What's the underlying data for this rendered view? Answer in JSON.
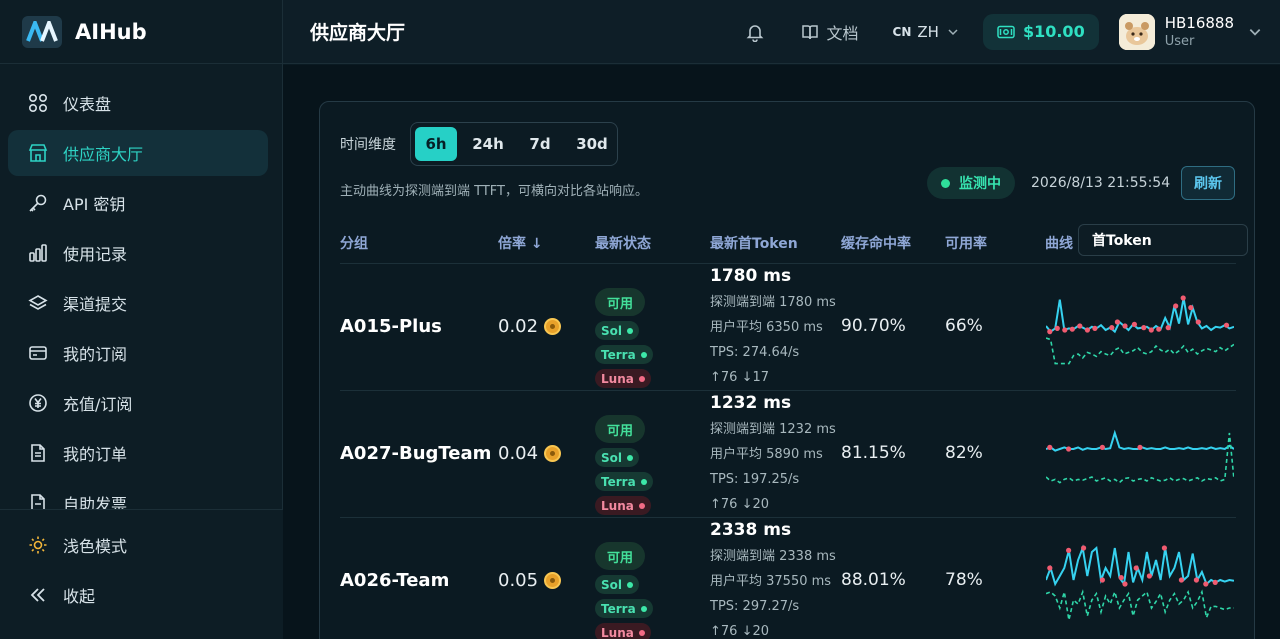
{
  "brand": {
    "name": "AIHub"
  },
  "sidebar": {
    "items": [
      {
        "label": "仪表盘",
        "icon": "dashboard-icon"
      },
      {
        "label": "供应商大厅",
        "icon": "store-icon",
        "active": true
      },
      {
        "label": "API 密钥",
        "icon": "key-icon"
      },
      {
        "label": "使用记录",
        "icon": "bar-chart-icon"
      },
      {
        "label": "渠道提交",
        "icon": "layers-icon"
      },
      {
        "label": "我的订阅",
        "icon": "card-icon"
      },
      {
        "label": "充值/订阅",
        "icon": "yen-icon"
      },
      {
        "label": "我的订单",
        "icon": "document-icon"
      },
      {
        "label": "自助发票",
        "icon": "invoice-icon"
      }
    ],
    "footer": {
      "theme_label": "浅色模式",
      "collapse_label": "收起"
    }
  },
  "topbar": {
    "title": "供应商大厅",
    "docs_label": "文档",
    "lang_flag": "CN",
    "lang": "ZH",
    "balance": "$10.00",
    "user": {
      "name": "HB16888",
      "role": "User"
    }
  },
  "controls": {
    "time_label": "时间维度",
    "ranges": [
      "6h",
      "24h",
      "7d",
      "30d"
    ],
    "active_range": "6h",
    "description": "主动曲线为探测端到端 TTFT，可横向对比各站响应。",
    "monitor_label": "监测中",
    "timestamp": "2026/8/13 21:55:54",
    "refresh_label": "刷新"
  },
  "table": {
    "headers": {
      "group": "分组",
      "rate": "倍率 ↓",
      "status": "最新状态",
      "token": "最新首Token",
      "cache": "缓存命中率",
      "avail": "可用率",
      "curve": "曲线"
    },
    "curve_select": "首Token",
    "rows": [
      {
        "group": "A015-Plus",
        "rate": "0.02",
        "status": "可用",
        "tags": [
          {
            "name": "Sol",
            "ok": true
          },
          {
            "name": "Terra",
            "ok": true
          },
          {
            "name": "Luna",
            "ok": false
          }
        ],
        "token_main": "1780 ms",
        "probe": "探测端到端 1780 ms",
        "user_avg": "用户平均 6350 ms",
        "tps": "TPS: 274.64/s",
        "io": "↑76 ↓17",
        "cache": "90.70%",
        "avail": "66%",
        "spark_top": [
          0.45,
          0.52,
          0.48,
          0.12,
          0.5,
          0.48,
          0.49,
          0.45,
          0.47,
          0.5,
          0.46,
          0.48,
          0.44,
          0.5,
          0.47,
          0.52,
          0.4,
          0.45,
          0.5,
          0.43,
          0.48,
          0.47,
          0.46,
          0.5,
          0.45,
          0.49,
          0.35,
          0.47,
          0.2,
          0.42,
          0.1,
          0.43,
          0.22,
          0.4,
          0.48,
          0.45,
          0.5,
          0.46,
          0.47,
          0.44,
          0.48,
          0.46
        ],
        "spark_bottom": [
          0.6,
          0.62,
          0.92,
          0.92,
          0.92,
          0.92,
          0.82,
          0.8,
          0.85,
          0.78,
          0.8,
          0.83,
          0.77,
          0.8,
          0.82,
          0.75,
          0.72,
          0.8,
          0.78,
          0.76,
          0.72,
          0.78,
          0.8,
          0.77,
          0.7,
          0.75,
          0.78,
          0.74,
          0.8,
          0.76,
          0.7,
          0.78,
          0.74,
          0.8,
          0.76,
          0.73,
          0.75,
          0.77,
          0.72,
          0.76,
          0.72,
          0.68
        ],
        "spark_dots": [
          0.02,
          0.06,
          0.1,
          0.14,
          0.18,
          0.22,
          0.26,
          0.35,
          0.38,
          0.42,
          0.47,
          0.52,
          0.56,
          0.6,
          0.65,
          0.69,
          0.73,
          0.77,
          0.81,
          0.96
        ]
      },
      {
        "group": "A027-BugTeam",
        "rate": "0.04",
        "status": "可用",
        "tags": [
          {
            "name": "Sol",
            "ok": true
          },
          {
            "name": "Terra",
            "ok": true
          },
          {
            "name": "Luna",
            "ok": false
          }
        ],
        "token_main": "1232 ms",
        "probe": "探测端到端 1232 ms",
        "user_avg": "用户平均 5890 ms",
        "tps": "TPS: 197.25/s",
        "io": "↑76 ↓20",
        "cache": "81.15%",
        "avail": "82%",
        "spark_top": [
          0.4,
          0.38,
          0.42,
          0.4,
          0.38,
          0.4,
          0.4,
          0.38,
          0.41,
          0.39,
          0.4,
          0.4,
          0.38,
          0.4,
          0.39,
          0.2,
          0.38,
          0.4,
          0.39,
          0.4,
          0.4,
          0.38,
          0.4,
          0.39,
          0.4,
          0.4,
          0.38,
          0.4,
          0.4,
          0.39,
          0.4,
          0.38,
          0.4,
          0.4,
          0.39,
          0.4,
          0.38,
          0.4,
          0.39,
          0.4,
          0.36,
          0.4
        ],
        "spark_bottom": [
          0.75,
          0.8,
          0.78,
          0.82,
          0.78,
          0.76,
          0.8,
          0.78,
          0.79,
          0.77,
          0.75,
          0.8,
          0.78,
          0.76,
          0.8,
          0.78,
          0.82,
          0.77,
          0.76,
          0.8,
          0.78,
          0.77,
          0.8,
          0.76,
          0.78,
          0.8,
          0.79,
          0.76,
          0.8,
          0.78,
          0.77,
          0.8,
          0.78,
          0.76,
          0.8,
          0.77,
          0.78,
          0.76,
          0.8,
          0.78,
          0.2,
          0.78
        ],
        "spark_dots": [
          0.02,
          0.12,
          0.3,
          0.5
        ]
      },
      {
        "group": "A026-Team",
        "rate": "0.05",
        "status": "可用",
        "tags": [
          {
            "name": "Sol",
            "ok": true
          },
          {
            "name": "Terra",
            "ok": true
          },
          {
            "name": "Luna",
            "ok": false
          }
        ],
        "token_main": "2338 ms",
        "probe": "探测端到端 2338 ms",
        "user_avg": "用户平均 37550 ms",
        "tps": "TPS: 297.27/s",
        "io": "↑76 ↓20",
        "cache": "88.01%",
        "avail": "78%",
        "spark_top": [
          0.45,
          0.3,
          0.5,
          0.4,
          0.3,
          0.08,
          0.45,
          0.2,
          0.05,
          0.4,
          0.1,
          0.05,
          0.45,
          0.3,
          0.4,
          0.05,
          0.42,
          0.5,
          0.1,
          0.48,
          0.3,
          0.45,
          0.1,
          0.4,
          0.2,
          0.45,
          0.05,
          0.4,
          0.3,
          0.1,
          0.45,
          0.4,
          0.12,
          0.45,
          0.35,
          0.5,
          0.45,
          0.48,
          0.45,
          0.47,
          0.45,
          0.46
        ],
        "spark_bottom": [
          0.62,
          0.6,
          0.65,
          0.8,
          0.6,
          0.95,
          0.7,
          0.75,
          0.6,
          0.9,
          0.7,
          0.62,
          0.85,
          0.65,
          0.75,
          0.6,
          0.8,
          0.7,
          0.62,
          0.9,
          0.7,
          0.65,
          0.6,
          0.8,
          0.72,
          0.62,
          0.85,
          0.7,
          0.62,
          0.75,
          0.7,
          0.6,
          0.8,
          0.72,
          0.6,
          0.92,
          0.78,
          0.78,
          0.8,
          0.82,
          0.8,
          0.8
        ],
        "spark_dots": [
          0.02,
          0.12,
          0.2,
          0.3,
          0.4,
          0.42,
          0.48,
          0.55,
          0.63,
          0.72,
          0.8,
          0.85,
          0.9
        ]
      }
    ]
  },
  "colors": {
    "accent": "#26d0c6",
    "spark_line": "#36d2f0",
    "spark_dash": "#2fd6a8",
    "spark_dot": "#f05b70"
  }
}
